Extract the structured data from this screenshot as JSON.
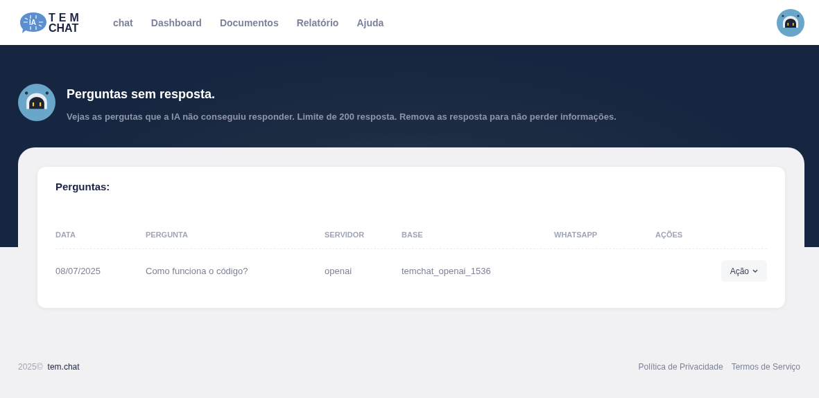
{
  "logo": {
    "badge": "IA",
    "line_1": "TEM",
    "line_2": "CHAT"
  },
  "nav": [
    {
      "label": "chat"
    },
    {
      "label": "Dashboard"
    },
    {
      "label": "Documentos"
    },
    {
      "label": "Relatório"
    },
    {
      "label": "Ajuda"
    }
  ],
  "hero": {
    "title": "Perguntas sem resposta.",
    "subtitle": "Vejas as pergutas que a IA não conseguiu responder. Limite de 200 resposta. Remova as resposta para não perder informações."
  },
  "card": {
    "title": "Perguntas:"
  },
  "table": {
    "columns": [
      "DATA",
      "PERGUNTA",
      "SERVIDOR",
      "BASE",
      "WHATSAPP",
      "AÇÕES"
    ],
    "rows": [
      {
        "cells": [
          "08/07/2025",
          "Como funciona o código?",
          "openai",
          "temchat_openai_1536",
          ""
        ],
        "action": "Ação"
      }
    ]
  },
  "footer": {
    "year": "2025©",
    "brand": "tem.chat",
    "links": [
      "Política de Privacidade",
      "Termos de Serviço"
    ]
  }
}
